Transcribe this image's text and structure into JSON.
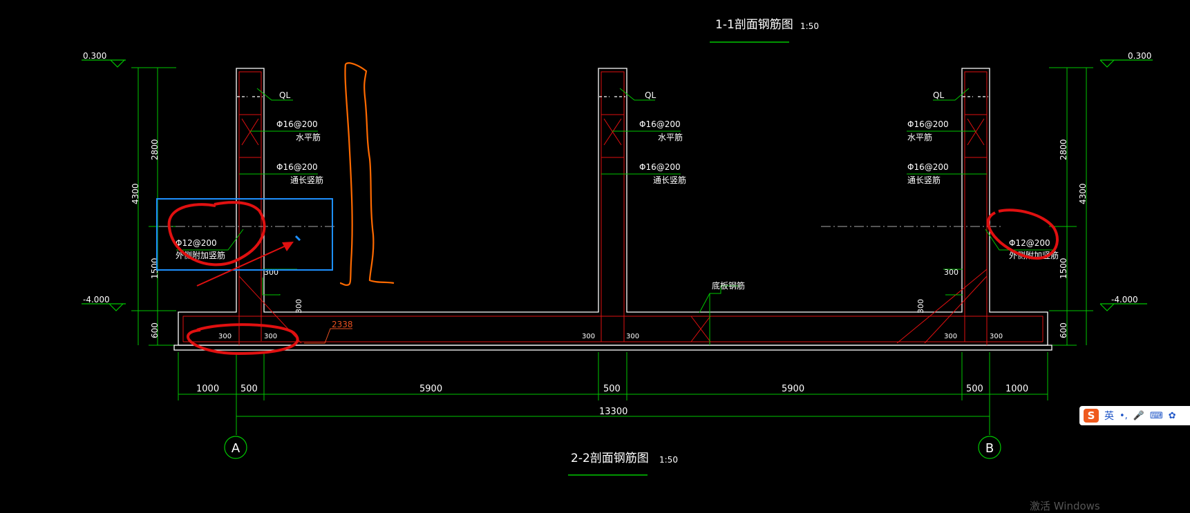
{
  "colors": {
    "background": "#000000",
    "dim": "#00c800",
    "outline": "#ffffff",
    "rebar": "#e01010",
    "text": "#ffffff",
    "red_mark": "#e01010",
    "orange_mark": "#ff6a00",
    "blue_box": "#1e90ff",
    "leader": "#00c800"
  },
  "titles": {
    "top": {
      "text": "1-1剖面钢筋图",
      "scale": "1:50"
    },
    "bottom": {
      "text": "2-2剖面钢筋图",
      "scale": "1:50"
    }
  },
  "elevations": {
    "top_left": "0.300",
    "top_right": "0.300",
    "bottom_left": "-4.000",
    "bottom_right": "-4.000"
  },
  "vertical_dims": {
    "left": [
      "2800",
      "1500",
      "600"
    ],
    "left_total": "4300",
    "right": [
      "2800",
      "1500",
      "600"
    ],
    "right_total": "4300"
  },
  "horizontal_dims": {
    "segments": [
      "1000",
      "500",
      "5900",
      "500",
      "5900",
      "500",
      "1000"
    ],
    "total": "13300"
  },
  "axes": [
    "A",
    "B"
  ],
  "wall_labels": {
    "ql": "QL",
    "horizontal_bar": "Φ16@200",
    "horizontal_bar_name": "水平筋",
    "vertical_bar": "Φ16@200",
    "vertical_bar_name": "通长竖筋",
    "added_bar": "Φ12@200",
    "added_bar_name": "外侧附加竖筋",
    "base_slab_name": "底板钢筋"
  },
  "haunch_dims": {
    "left_h": "300",
    "left_v": "300",
    "right_h": "300",
    "right_v": "300"
  },
  "slab_dims": [
    "300",
    "300",
    "300",
    "300",
    "300",
    "300"
  ],
  "red_length": "2338",
  "ime": {
    "logo": "S",
    "lang": "英",
    "icons": [
      "punct-icon",
      "mic-icon",
      "keyboard-icon",
      "skin-icon"
    ]
  },
  "watermark": "激活 Windows"
}
